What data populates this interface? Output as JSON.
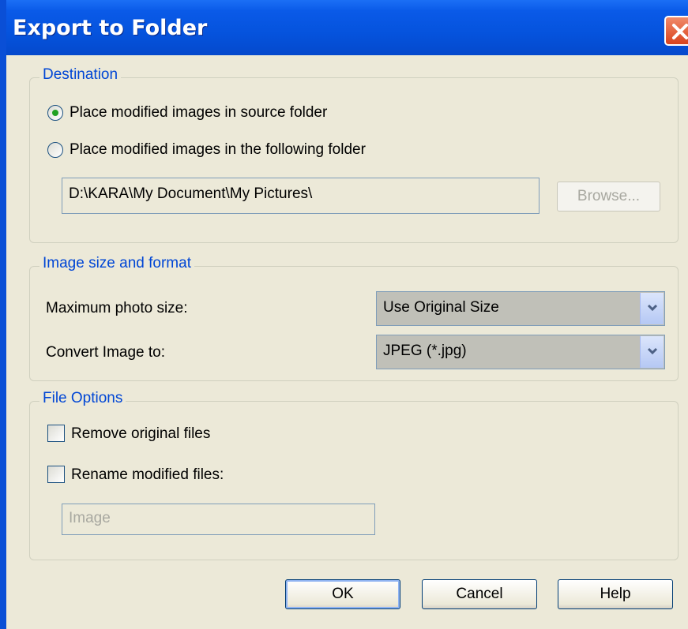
{
  "window": {
    "title": "Export to Folder"
  },
  "destination": {
    "legend": "Destination",
    "option_source_label": "Place modified images in source folder",
    "option_folder_label": "Place modified images in the following folder",
    "selected": "source",
    "folder_path": "D:\\KARA\\My Document\\My Pictures\\",
    "browse_label": "Browse..."
  },
  "image_size_format": {
    "legend": "Image size and format",
    "max_size_label": "Maximum photo size:",
    "max_size_value": "Use Original Size",
    "convert_label": "Convert Image to:",
    "convert_value": "JPEG (*.jpg)"
  },
  "file_options": {
    "legend": "File Options",
    "remove_label": "Remove original files",
    "remove_checked": false,
    "rename_label": "Rename modified files:",
    "rename_checked": false,
    "rename_value": "Image"
  },
  "buttons": {
    "ok": "OK",
    "cancel": "Cancel",
    "help": "Help"
  },
  "colors": {
    "title_bar": "#0553dd",
    "legend_text": "#0046d5",
    "close_button": "#d9431d"
  },
  "icons": [
    "close-icon",
    "chevron-down-icon"
  ]
}
